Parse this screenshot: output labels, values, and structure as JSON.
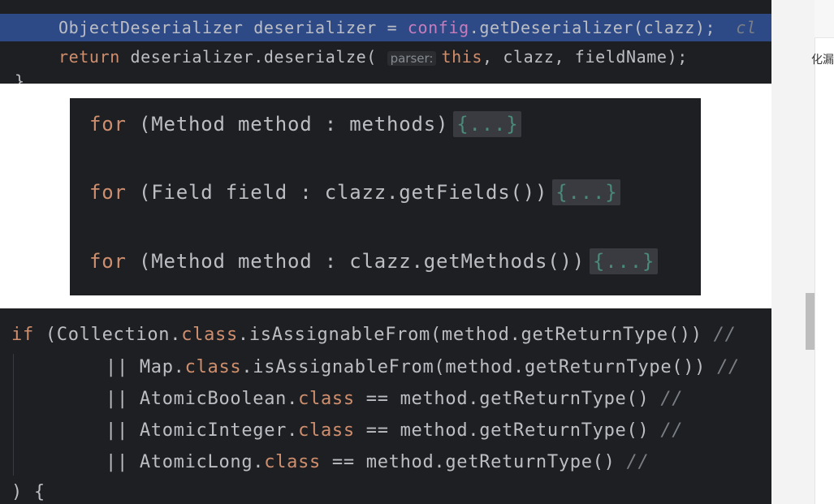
{
  "block1": {
    "line1": {
      "type": "ObjectDeserializer",
      "var": "deserializer",
      "assign": "=",
      "field": "config",
      "call": ".getDeserializer(clazz);",
      "trailing": "cl"
    },
    "line2": {
      "keyword": "return",
      "call": "deserializer.deserialze(",
      "hint": "parser:",
      "this": "this",
      "rest": ", clazz, fieldName);"
    },
    "closing": "}"
  },
  "block2": {
    "rows": [
      {
        "keyword": "for",
        "text": "(Method method : methods)",
        "fold": "{...}"
      },
      {
        "keyword": "for",
        "text": "(Field field : clazz.getFields())",
        "fold": "{...}"
      },
      {
        "keyword": "for",
        "text": "(Method method : clazz.getMethods())",
        "fold": "{...}"
      }
    ]
  },
  "block3": {
    "line1": {
      "kw": "if",
      "pre": "(Collection.",
      "cls": "class",
      "post": ".isAssignableFrom(method.getReturnType())",
      "cmt": "//"
    },
    "line2": {
      "pre": "|| Map.",
      "cls": "class",
      "post": ".isAssignableFrom(method.getReturnType())",
      "cmt": "//"
    },
    "line3": {
      "pre": "|| AtomicBoolean.",
      "cls": "class",
      "post": " == method.getReturnType()",
      "cmt": "//"
    },
    "line4": {
      "pre": "|| AtomicInteger.",
      "cls": "class",
      "post": " == method.getReturnType()",
      "cmt": "//"
    },
    "line5": {
      "pre": "|| AtomicLong.",
      "cls": "class",
      "post": " == method.getReturnType()",
      "cmt": "//"
    },
    "line6": ") {"
  },
  "side": {
    "text": "化漏"
  },
  "colors": {
    "editor_bg": "#1e1f22",
    "selection": "#2d4a87",
    "keyword": "#cf8e6d",
    "field": "#c77dbb",
    "comment": "#7a7e85",
    "text": "#bcbec4"
  }
}
